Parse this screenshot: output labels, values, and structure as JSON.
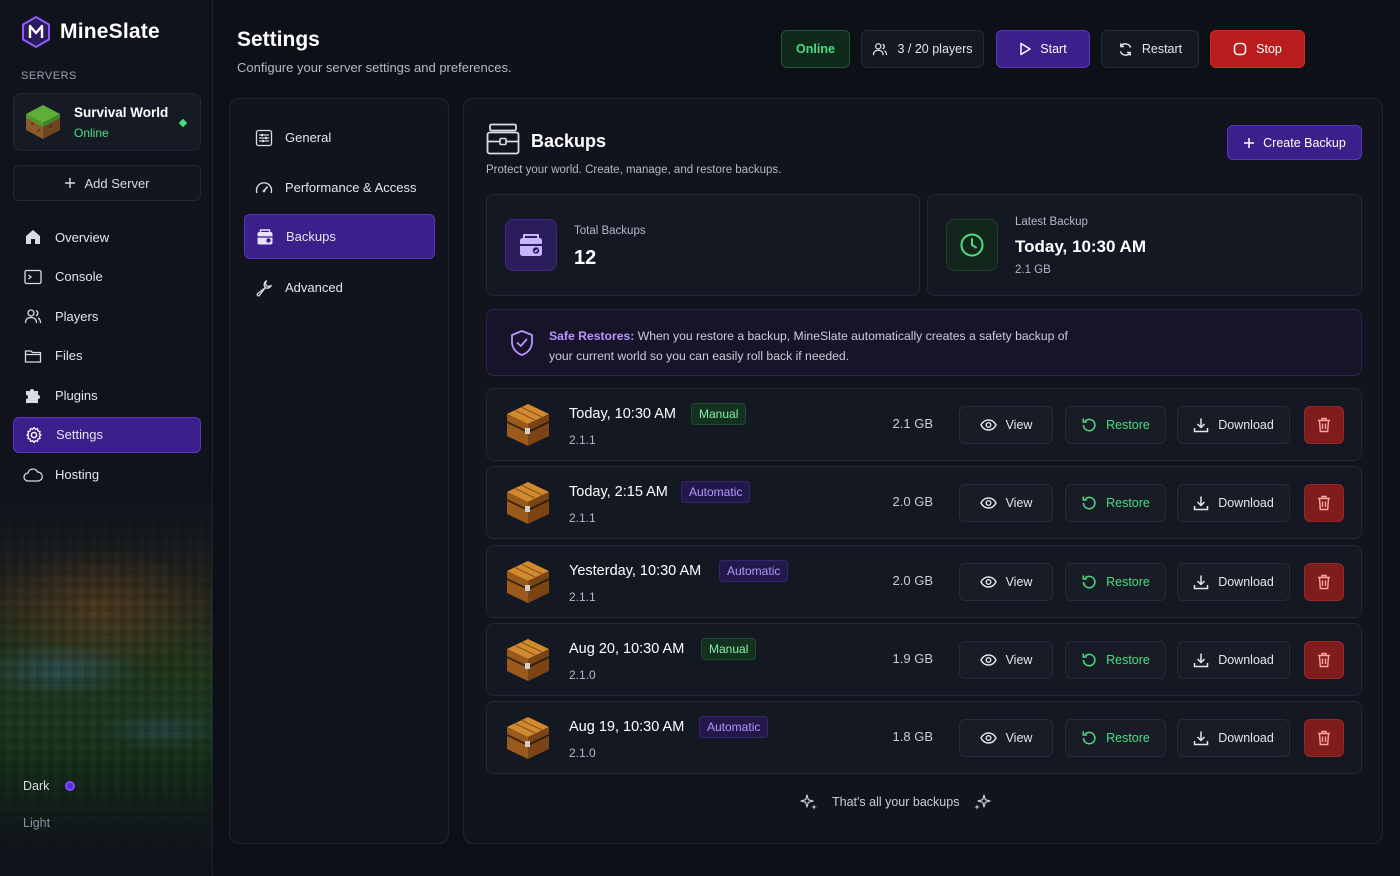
{
  "brand": {
    "name": "MineSlate"
  },
  "sidebar": {
    "section_label": "SERVERS",
    "server": {
      "name": "Survival World",
      "status": "Online"
    },
    "add_server_label": "Add Server",
    "nav": [
      {
        "label": "Overview",
        "icon": "home-icon"
      },
      {
        "label": "Console",
        "icon": "terminal-icon"
      },
      {
        "label": "Players",
        "icon": "users-icon"
      },
      {
        "label": "Files",
        "icon": "folder-icon"
      },
      {
        "label": "Plugins",
        "icon": "puzzle-icon"
      },
      {
        "label": "Settings",
        "icon": "gear-icon",
        "active": true
      },
      {
        "label": "Hosting",
        "icon": "cloud-icon"
      }
    ],
    "theme": {
      "dark_label": "Dark",
      "light_label": "Light",
      "selected": "Dark"
    }
  },
  "header": {
    "title": "Settings",
    "subtitle": "Configure your server settings and preferences.",
    "status_label": "Online",
    "players_label": "3 / 20 players",
    "start_label": "Start",
    "restart_label": "Restart",
    "stop_label": "Stop"
  },
  "settings_nav": [
    {
      "label": "General",
      "icon": "sliders-icon"
    },
    {
      "label": "Performance & Access",
      "icon": "gauge-icon"
    },
    {
      "label": "Backups",
      "icon": "backup-icon",
      "active": true
    },
    {
      "label": "Advanced",
      "icon": "wrench-icon"
    }
  ],
  "main": {
    "title": "Backups",
    "subtitle": "Protect your world. Create, manage, and restore backups.",
    "create_label": "Create Backup",
    "stats": {
      "total_label": "Total Backups",
      "total_value": "12",
      "latest_label": "Latest Backup",
      "latest_value": "Today, 10:30 AM",
      "latest_size": "2.1 GB"
    },
    "info": {
      "strong": "Safe Restores:",
      "text": " When you restore a backup, MineSlate automatically creates a safety backup of your current world so you can easily roll back if needed."
    },
    "row_actions": {
      "view": "View",
      "restore": "Restore",
      "download": "Download"
    },
    "backups": [
      {
        "title": "Today, 10:30 AM",
        "badge": "Manual",
        "version": "2.1.1",
        "size": "2.1 GB"
      },
      {
        "title": "Today, 2:15 AM",
        "badge": "Automatic",
        "version": "2.1.1",
        "size": "2.0 GB"
      },
      {
        "title": "Yesterday, 10:30 AM",
        "badge": "Automatic",
        "version": "2.1.1",
        "size": "2.0 GB"
      },
      {
        "title": "Aug 20, 10:30 AM",
        "badge": "Manual",
        "version": "2.1.0",
        "size": "1.9 GB"
      },
      {
        "title": "Aug 19, 10:30 AM",
        "badge": "Automatic",
        "version": "2.1.0",
        "size": "1.8 GB"
      }
    ],
    "footer": "That's all your backups"
  },
  "colors": {
    "accent": "#3b1f8a",
    "accent_light": "#b794ff",
    "success": "#4ade80",
    "danger": "#b91c1c",
    "background": "#0d1017"
  }
}
